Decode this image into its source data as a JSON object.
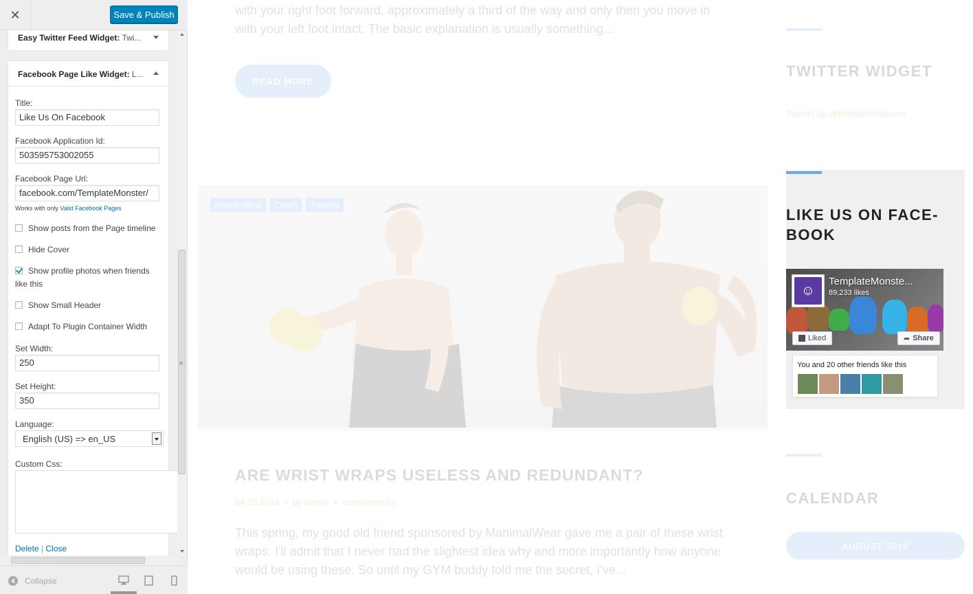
{
  "topbar": {
    "close_icon": "close-icon",
    "save_label": "Save & Publish"
  },
  "widgets": [
    {
      "title": "Easy Twitter Feed Widget:",
      "subtitle": " Twi...",
      "state": "collapsed"
    },
    {
      "title": "Facebook Page Like Widget:",
      "subtitle": " L...",
      "state": "expanded"
    }
  ],
  "form": {
    "title_label": "Title:",
    "title_value": "Like Us On Facebook",
    "app_id_label": "Facebook Application Id:",
    "app_id_value": "503595753002055",
    "page_url_label": "Facebook Page Url:",
    "page_url_value": "facebook.com/TemplateMonster/",
    "hint_prefix": "Works with only",
    "hint_link": "Valid Facebook Pages",
    "checkboxes": [
      {
        "label": "Show posts from the Page timeline",
        "checked": false
      },
      {
        "label": "Hide Cover",
        "checked": false
      },
      {
        "label": "Show profile photos when friends like this",
        "checked": true
      },
      {
        "label": "Show Small Header",
        "checked": false
      },
      {
        "label": "Adapt To Plugin Container Width",
        "checked": false
      }
    ],
    "width_label": "Set Width:",
    "width_value": "250",
    "height_label": "Set Height:",
    "height_value": "350",
    "language_label": "Language:",
    "language_value": "English (US) => en_US",
    "css_label": "Custom Css:",
    "delete_label": "Delete",
    "separator": "|",
    "close_label": "Close"
  },
  "footer": {
    "collapse_label": "Collapse"
  },
  "preview": {
    "excerpt_top": "with your right foot forward, approximately a third of the way and only then you move in with your left foot intact. The basic explanation is usually something...",
    "read_more": "READ MORE",
    "tags": [
      "Bodybuilding",
      "Coach",
      "Training"
    ],
    "post_title": "ARE WRIST WRAPS USELESS AND REDUNDANT?",
    "post_date": "04.03.2016",
    "post_by": "by",
    "post_author": "admin",
    "post_comments": "comments (0)",
    "excerpt_bottom": "This spring, my good old friend sponsored by ManimalWear gave me a pair of these wrist wraps. I'll admit that I never had the slightest idea why and more importantly how anyone would be using these. So until my GYM buddy told me the secret, I've..."
  },
  "sidebar": {
    "twitter_title": "TWITTER WIDGET",
    "tweets_by": "Tweets by @templatehelpcom",
    "like_title": "LIKE US ON FACE-BOOK",
    "fb_page_name": "TemplateMonste...",
    "fb_likes": "89,233 likes",
    "fb_liked": "Liked",
    "fb_share": "Share",
    "fb_friends_text": "You and 20 other friends like this",
    "calendar_title": "CALENDAR",
    "calendar_month": "AUGUST 2016"
  },
  "colors": {
    "accent": "#0085ba",
    "brand_blue": "#6aa6e8",
    "orange": "#e88a3c"
  }
}
